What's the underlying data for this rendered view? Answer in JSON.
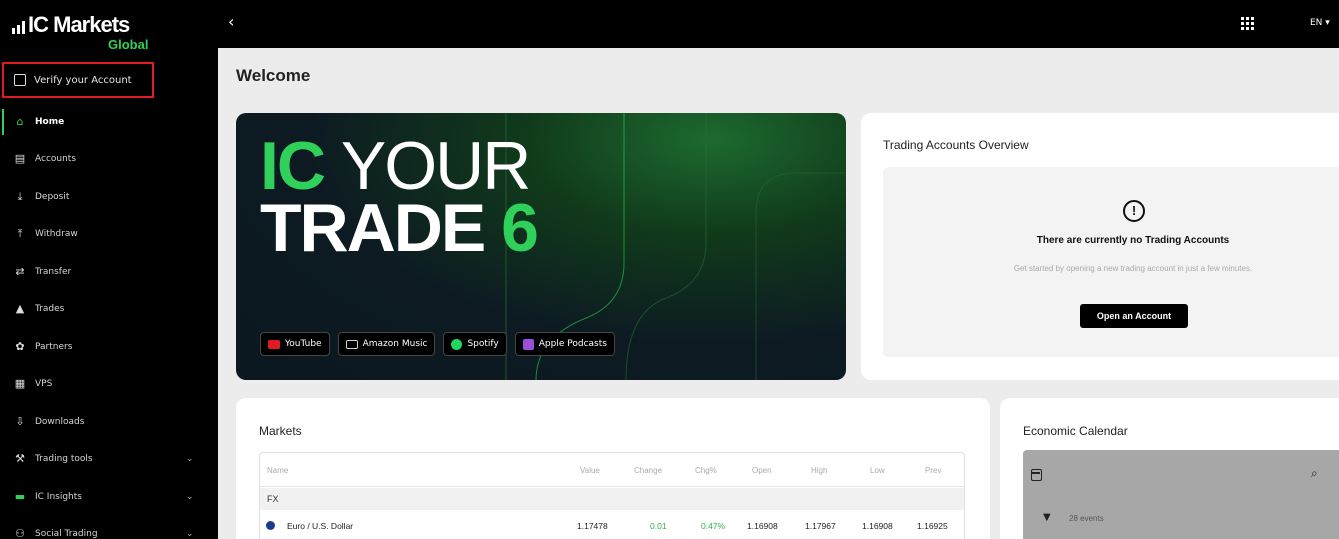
{
  "brand": {
    "name": "IC Markets",
    "sub": "Global"
  },
  "sidebar": {
    "verify_label": "Verify your Account",
    "items": [
      {
        "label": "Home",
        "icon": "home-icon"
      },
      {
        "label": "Accounts",
        "icon": "accounts-icon"
      },
      {
        "label": "Deposit",
        "icon": "deposit-icon"
      },
      {
        "label": "Withdraw",
        "icon": "withdraw-icon"
      },
      {
        "label": "Transfer",
        "icon": "transfer-icon"
      },
      {
        "label": "Trades",
        "icon": "trades-icon"
      },
      {
        "label": "Partners",
        "icon": "partners-icon"
      },
      {
        "label": "VPS",
        "icon": "vps-icon"
      },
      {
        "label": "Downloads",
        "icon": "downloads-icon"
      },
      {
        "label": "Trading tools",
        "icon": "trading-tools-icon"
      },
      {
        "label": "IC Insights",
        "icon": "insights-icon"
      },
      {
        "label": "Social Trading",
        "icon": "social-trading-icon"
      }
    ]
  },
  "topbar": {
    "back": "‹",
    "lang": "EN ▾"
  },
  "main": {
    "title": "Welcome"
  },
  "banner": {
    "line1_ic": "IC",
    "line1_rest": "YOUR",
    "line2_main": "TRADE",
    "line2_num": "6",
    "badges": [
      {
        "label": "YouTube",
        "color": "#e21b22"
      },
      {
        "label": "Amazon Music",
        "color": "#cfcfcf"
      },
      {
        "label": "Spotify",
        "color": "#1ed760"
      },
      {
        "label": "Apple Podcasts",
        "color": "#9b4fd8"
      }
    ]
  },
  "accounts": {
    "title": "Trading Accounts Overview",
    "alert_symbol": "!",
    "empty_title": "There are currently no Trading Accounts",
    "empty_sub": "Get started by opening a new trading account in just a few minutes.",
    "open_button": "Open an Account"
  },
  "markets": {
    "title": "Markets",
    "columns": [
      "Name",
      "Value",
      "Change",
      "Chg%",
      "Open",
      "High",
      "Low",
      "Prev"
    ],
    "group": "FX",
    "row": {
      "name": "Euro / U.S. Dollar",
      "value": "1.17478",
      "change": "0.01",
      "chg_pct": "0.47%",
      "open": "1.16908",
      "high": "1.17967",
      "low": "1.16908",
      "prev": "1.16925"
    }
  },
  "calendar": {
    "title": "Economic Calendar",
    "events": "28 events"
  },
  "colors": {
    "accent": "#2fd15a",
    "highlight_border": "#e21b22",
    "positive": "#2db24a"
  }
}
